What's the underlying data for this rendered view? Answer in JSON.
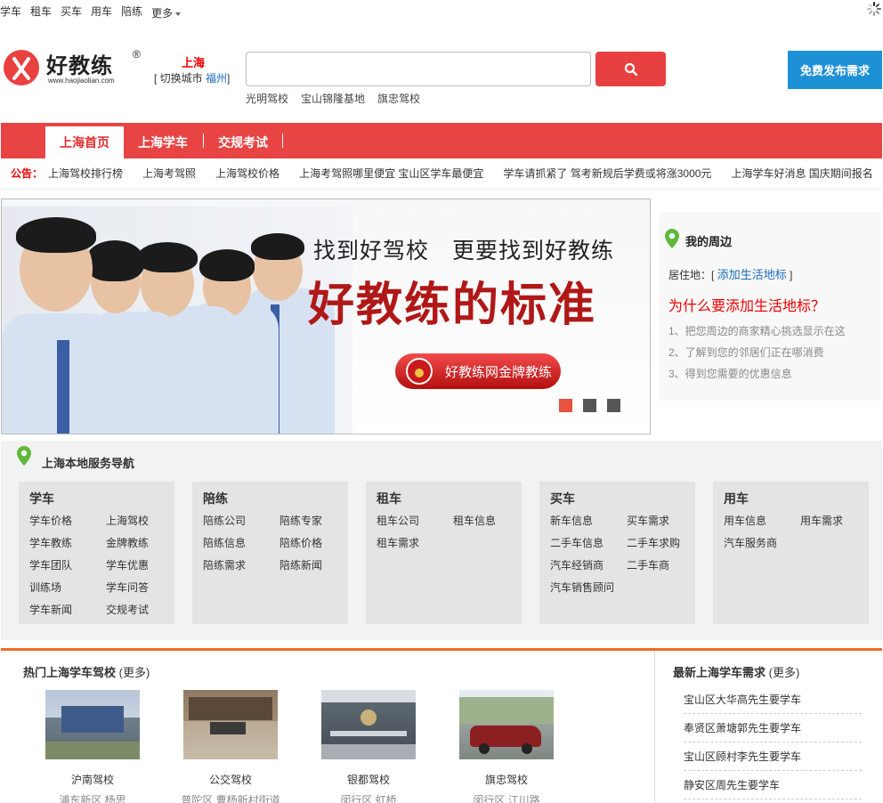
{
  "topnav": {
    "items": [
      "学车",
      "租车",
      "买车",
      "用车",
      "陪练"
    ],
    "more": "更多"
  },
  "header": {
    "logo_text": "好教练",
    "logo_reg": "®",
    "logo_url": "www.haojiaolian.com",
    "city": "上海",
    "city_switch_open": "[ 切换城市",
    "city_alt": "福州",
    "city_switch_close": "]",
    "search_placeholder": "",
    "hotwords": [
      "光明驾校",
      "宝山锦隆基地",
      "旗忠驾校"
    ],
    "publish_label": "免费发布需求"
  },
  "nav": {
    "tabs": [
      "上海首页",
      "上海学车",
      "交规考试"
    ]
  },
  "notice": {
    "label": "公告：",
    "items": [
      "上海驾校排行榜",
      "上海考驾照",
      "上海驾校价格",
      "上海考驾照哪里便宜 宝山区学车最便宜",
      "学车请抓紧了 驾考新规后学费或将涨3000元",
      "上海学车好消息 国庆期间报名"
    ]
  },
  "banner": {
    "subtitle": "找到好驾校　更要找到好教练",
    "title": "好教练的标准",
    "pill": "好教练网金牌教练",
    "slides": 3,
    "active_slide": 1
  },
  "myarea": {
    "title": "我的周边",
    "loc_label": "居住地：[",
    "loc_link": "添加生活地标",
    "loc_close": "]",
    "why": "为什么要添加生活地标？",
    "tips": [
      "1、把您周边的商家精心挑选显示在这",
      "2、了解到您的邻居们正在哪消费",
      "3、得到您需要的优惠信息"
    ]
  },
  "services": {
    "title": "上海本地服务导航",
    "columns": [
      {
        "caption": "学车",
        "items": [
          "学车价格",
          "上海驾校",
          "学车教练",
          "金牌教练",
          "学车团队",
          "学车优惠",
          "训练场",
          "学车问答",
          "学车新闻",
          "交规考试"
        ]
      },
      {
        "caption": "陪练",
        "items": [
          "陪练公司",
          "陪练专家",
          "陪练信息",
          "陪练价格",
          "陪练需求",
          "陪练新闻"
        ]
      },
      {
        "caption": "租车",
        "items": [
          "租车公司",
          "租车信息",
          "租车需求"
        ]
      },
      {
        "caption": "买车",
        "items": [
          "新车信息",
          "买车需求",
          "二手车信息",
          "二手车求购",
          "汽车经销商",
          "二手车商",
          "汽车销售顾问"
        ]
      },
      {
        "caption": "用车",
        "items": [
          "用车信息",
          "用车需求",
          "汽车服务商"
        ]
      }
    ]
  },
  "hot": {
    "title": "热门上海学车驾校",
    "more": "(更多)",
    "schools": [
      {
        "name": "沪南驾校",
        "addr": "浦东新区 杨思"
      },
      {
        "name": "公交驾校",
        "addr": "普陀区 曹杨新村街道"
      },
      {
        "name": "银都驾校",
        "addr": "闵行区 虹桥"
      },
      {
        "name": "旗忠驾校",
        "addr": "闵行区 江川路"
      }
    ]
  },
  "newest": {
    "title": "最新上海学车需求",
    "more": "(更多)",
    "items": [
      "宝山区大华高先生要学车",
      "奉贤区萧塘郭先生要学车",
      "宝山区顾村李先生要学车",
      "静安区周先生要学车"
    ]
  },
  "colors": {
    "brand_red": "#e84444",
    "accent_blue": "#1e90d6",
    "link_blue": "#1a6bbf",
    "orange_line": "#f16a24"
  }
}
